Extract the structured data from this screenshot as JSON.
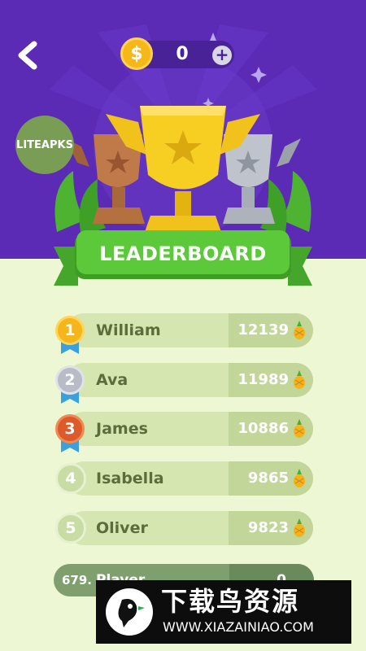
{
  "header": {
    "coins": "0",
    "plus_label": "+"
  },
  "badge": {
    "label": "LITEAPKS"
  },
  "banner": {
    "title": "LEADERBOARD"
  },
  "leaderboard": [
    {
      "rank": "1",
      "name": "William",
      "score": "12139",
      "medal": "gold"
    },
    {
      "rank": "2",
      "name": "Ava",
      "score": "11989",
      "medal": "silver"
    },
    {
      "rank": "3",
      "name": "James",
      "score": "10886",
      "medal": "bronze"
    },
    {
      "rank": "4",
      "name": "Isabella",
      "score": "9865",
      "medal": "none"
    },
    {
      "rank": "5",
      "name": "Oliver",
      "score": "9823",
      "medal": "none"
    }
  ],
  "current_player": {
    "rank": "679.",
    "name": "Player",
    "score": "0"
  },
  "watermark": {
    "title": "下载鸟资源",
    "url": "WWW.XIAZAINIAO.COM"
  },
  "colors": {
    "header_bg": "#5b2bb6",
    "body_bg": "#eef7d4",
    "banner_green": "#5cc93a",
    "gold": "#f5b51b",
    "silver": "#b8bcc6",
    "bronze": "#dd5a2a"
  },
  "icons": {
    "back": "chevron-left-icon",
    "coin": "dollar-coin-icon",
    "plus": "plus-icon",
    "fruit": "pineapple-icon"
  }
}
